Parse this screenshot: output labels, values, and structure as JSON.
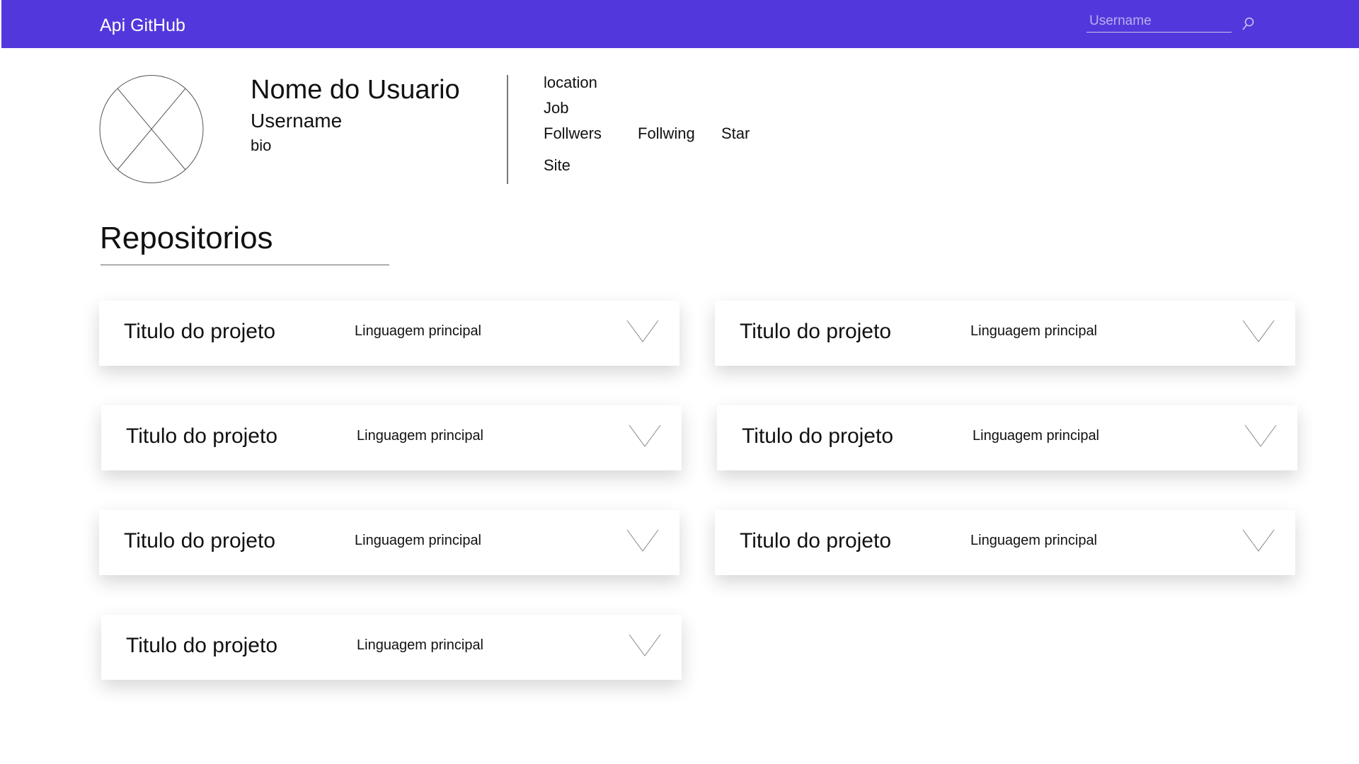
{
  "header": {
    "app_title": "Api GitHub",
    "search_placeholder": "Username",
    "search_icon": "search-icon",
    "bg_color": "#5238dc"
  },
  "profile": {
    "avatar_icon": "image-placeholder-icon",
    "name": "Nome do Usuario",
    "username": "Username",
    "bio": "bio",
    "location": "location",
    "job": "Job",
    "followers": "Follwers",
    "following": "Follwing",
    "star": "Star",
    "site": "Site"
  },
  "repositories": {
    "title": "Repositorios",
    "expand_icon": "chevron-down-icon",
    "items": [
      {
        "title": "Titulo do projeto",
        "language": "Linguagem principal"
      },
      {
        "title": "Titulo do projeto",
        "language": "Linguagem principal"
      },
      {
        "title": "Titulo do projeto",
        "language": "Linguagem principal"
      },
      {
        "title": "Titulo do projeto",
        "language": "Linguagem principal"
      },
      {
        "title": "Titulo do projeto",
        "language": "Linguagem principal"
      },
      {
        "title": "Titulo do projeto",
        "language": "Linguagem principal"
      },
      {
        "title": "Titulo do projeto",
        "language": "Linguagem principal"
      }
    ]
  }
}
